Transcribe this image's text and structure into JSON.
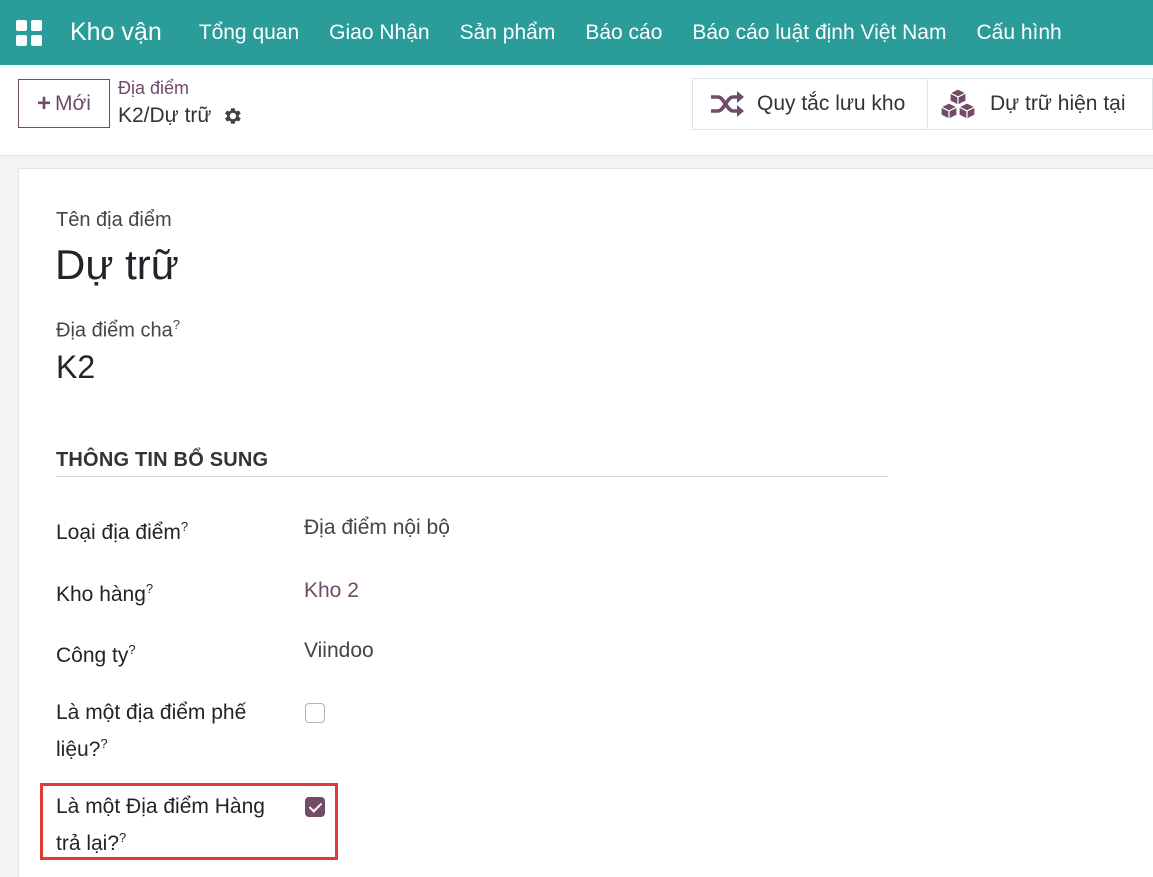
{
  "navbar": {
    "brand": "Kho vận",
    "menu": [
      "Tổng quan",
      "Giao Nhận",
      "Sản phẩm",
      "Báo cáo",
      "Báo cáo luật định Việt Nam",
      "Cấu hình"
    ]
  },
  "control": {
    "new_label": "Mới",
    "breadcrumb_parent": "Địa điểm",
    "breadcrumb_current": "K2/Dự trữ",
    "stat_buttons": [
      "Quy tắc lưu kho",
      "Dự trữ hiện tại"
    ]
  },
  "form": {
    "name_label": "Tên địa điểm",
    "name_value": "Dự trữ",
    "parent_label": "Địa điểm cha",
    "parent_value": "K2",
    "section_title": "THÔNG TIN BỔ SUNG",
    "fields": {
      "type_label": "Loại địa điểm",
      "type_value": "Địa điểm nội bộ",
      "warehouse_label": "Kho hàng",
      "warehouse_value": "Kho 2",
      "company_label": "Công ty",
      "company_value": "Viindoo",
      "scrap_label_1": "Là một địa điểm phế",
      "scrap_label_2": "liệu?",
      "scrap_checked": false,
      "return_label_1": "Là một Địa điểm Hàng",
      "return_label_2": "trả lại?",
      "return_checked": true
    },
    "help_mark": "?"
  },
  "colors": {
    "navbar": "#2a9d9a",
    "accent": "#714b67",
    "highlight": "#e53935"
  }
}
